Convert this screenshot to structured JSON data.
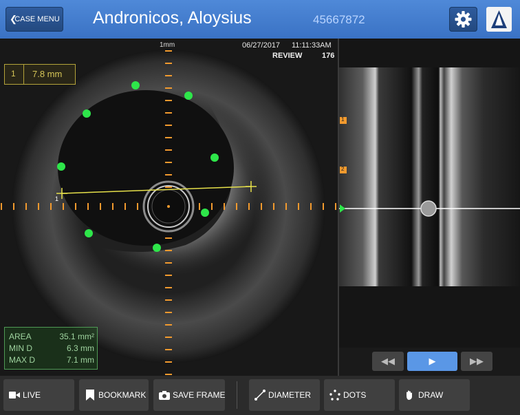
{
  "header": {
    "back_label": "CASE MENU",
    "patient_name": "Andronicos, Aloysius",
    "patient_id": "45667872",
    "settings_icon": "gear-icon",
    "logo_icon": "brand-logo-icon"
  },
  "image_info": {
    "scale_label": "1mm",
    "date": "06/27/2017",
    "time": "11:11:33AM",
    "mode": "REVIEW",
    "frame": "176"
  },
  "measurement": {
    "index": "1",
    "value": "7.8 mm",
    "endpoint_label": "1"
  },
  "stats": {
    "area_label": "AREA",
    "area_value": "35.1 mm²",
    "min_label": "MIN D",
    "min_value": "6.3 mm",
    "max_label": "MAX D",
    "max_value": "7.1 mm"
  },
  "longitudinal": {
    "bookmark_1": "1",
    "bookmark_2": "2"
  },
  "playback": {
    "rewind_icon": "rewind-icon",
    "play_icon": "play-icon",
    "forward_icon": "fast-forward-icon"
  },
  "toolbar": {
    "live_label": "LIVE",
    "bookmark_label": "BOOKMARK",
    "save_frame_label": "SAVE FRAME",
    "diameter_label": "DIAMETER",
    "dots_label": "DOTS",
    "draw_label": "DRAW"
  },
  "colors": {
    "header": "#3f79cb",
    "measure_yellow": "#d6c657",
    "trace_green": "#2ee64a",
    "scale_orange": "#f29a2e",
    "play_blue": "#5a97e6"
  }
}
